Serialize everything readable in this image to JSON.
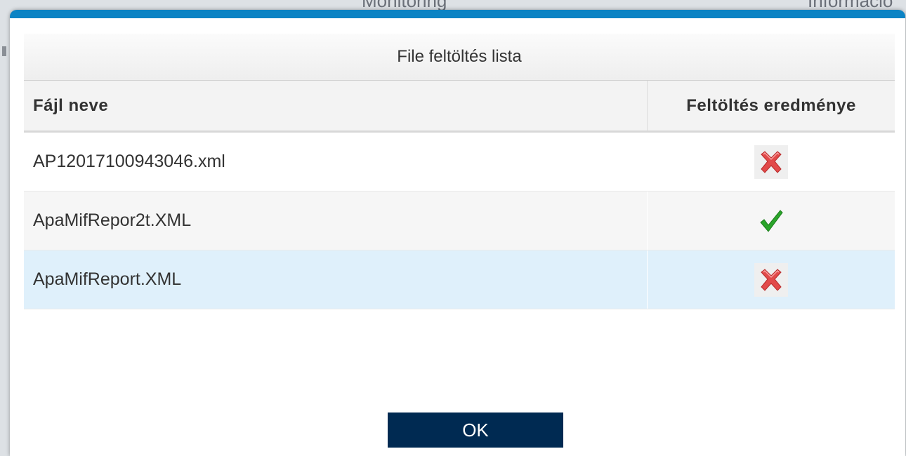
{
  "background": {
    "text_left": "Monitoring",
    "text_right": "Információ"
  },
  "dialog": {
    "title": "File feltöltés lista",
    "columns": {
      "name": "Fájl neve",
      "result": "Feltöltés eredménye"
    },
    "rows": [
      {
        "name": "AP12017100943046.xml",
        "result": "error-icon"
      },
      {
        "name": "ApaMifRepor2t.XML",
        "result": "success-icon"
      },
      {
        "name": "ApaMifReport.XML",
        "result": "error-icon"
      }
    ],
    "ok_label": "OK"
  },
  "colors": {
    "accent": "#0b83c4",
    "button": "#002a52",
    "selected_row": "#dff0fb",
    "error": "#e03a3a",
    "success": "#2aa52a"
  }
}
